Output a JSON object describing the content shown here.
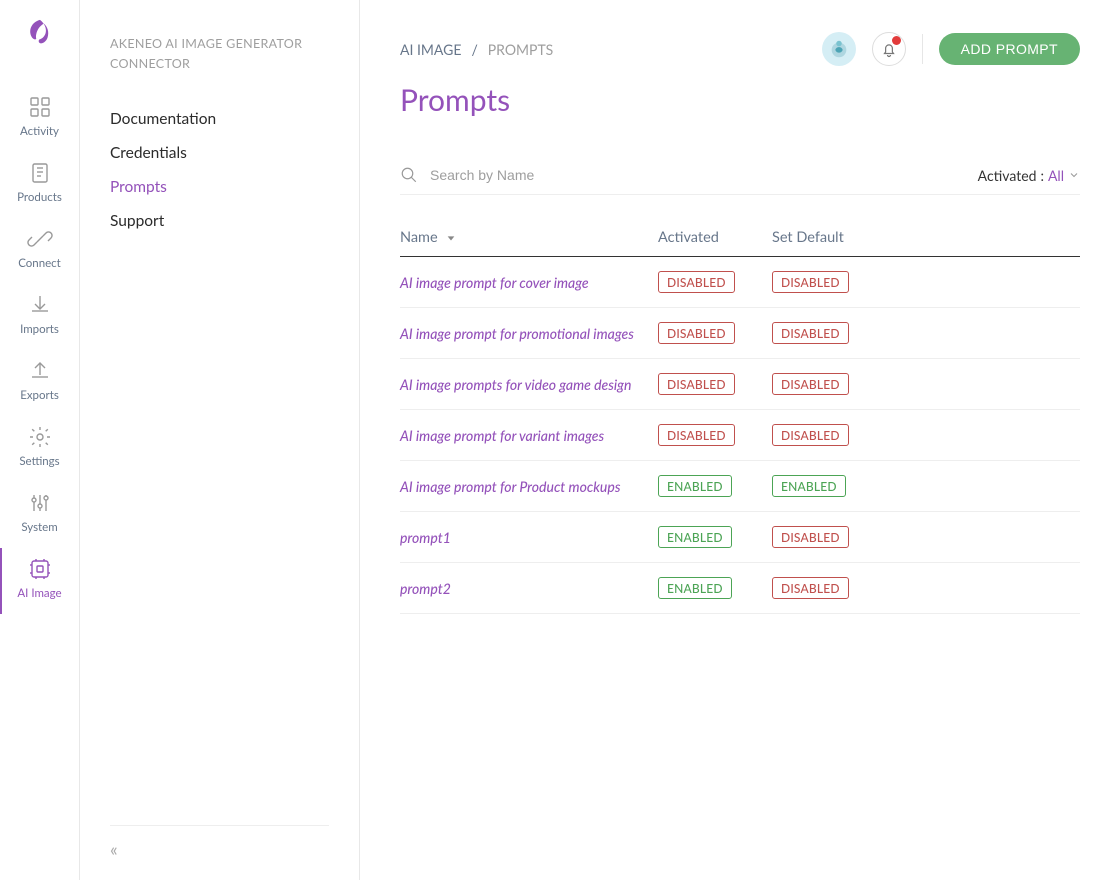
{
  "rail": {
    "items": [
      {
        "label": "Activity"
      },
      {
        "label": "Products"
      },
      {
        "label": "Connect"
      },
      {
        "label": "Imports"
      },
      {
        "label": "Exports"
      },
      {
        "label": "Settings"
      },
      {
        "label": "System"
      },
      {
        "label": "AI Image"
      }
    ]
  },
  "subnav": {
    "title": "AKENEO AI IMAGE GENERATOR CONNECTOR",
    "items": [
      {
        "label": "Documentation"
      },
      {
        "label": "Credentials"
      },
      {
        "label": "Prompts"
      },
      {
        "label": "Support"
      }
    ]
  },
  "header": {
    "breadcrumb_root": "AI IMAGE",
    "breadcrumb_current": "PROMPTS",
    "add_button": "ADD PROMPT",
    "page_title": "Prompts"
  },
  "toolbar": {
    "search_placeholder": "Search by Name",
    "filter_label": "Activated",
    "filter_value": "All"
  },
  "table": {
    "col_name": "Name",
    "col_activated": "Activated",
    "col_default": "Set Default",
    "badge_enabled": "ENABLED",
    "badge_disabled": "DISABLED",
    "rows": [
      {
        "name": "AI image prompt for cover image",
        "activated": "DISABLED",
        "default": "DISABLED"
      },
      {
        "name": "AI image prompt for promotional images",
        "activated": "DISABLED",
        "default": "DISABLED"
      },
      {
        "name": "AI image prompts for video game design",
        "activated": "DISABLED",
        "default": "DISABLED"
      },
      {
        "name": "AI image prompt for variant images",
        "activated": "DISABLED",
        "default": "DISABLED"
      },
      {
        "name": "AI image prompt for Product mockups",
        "activated": "ENABLED",
        "default": "ENABLED"
      },
      {
        "name": "prompt1",
        "activated": "ENABLED",
        "default": "DISABLED"
      },
      {
        "name": "prompt2",
        "activated": "ENABLED",
        "default": "DISABLED"
      }
    ]
  }
}
